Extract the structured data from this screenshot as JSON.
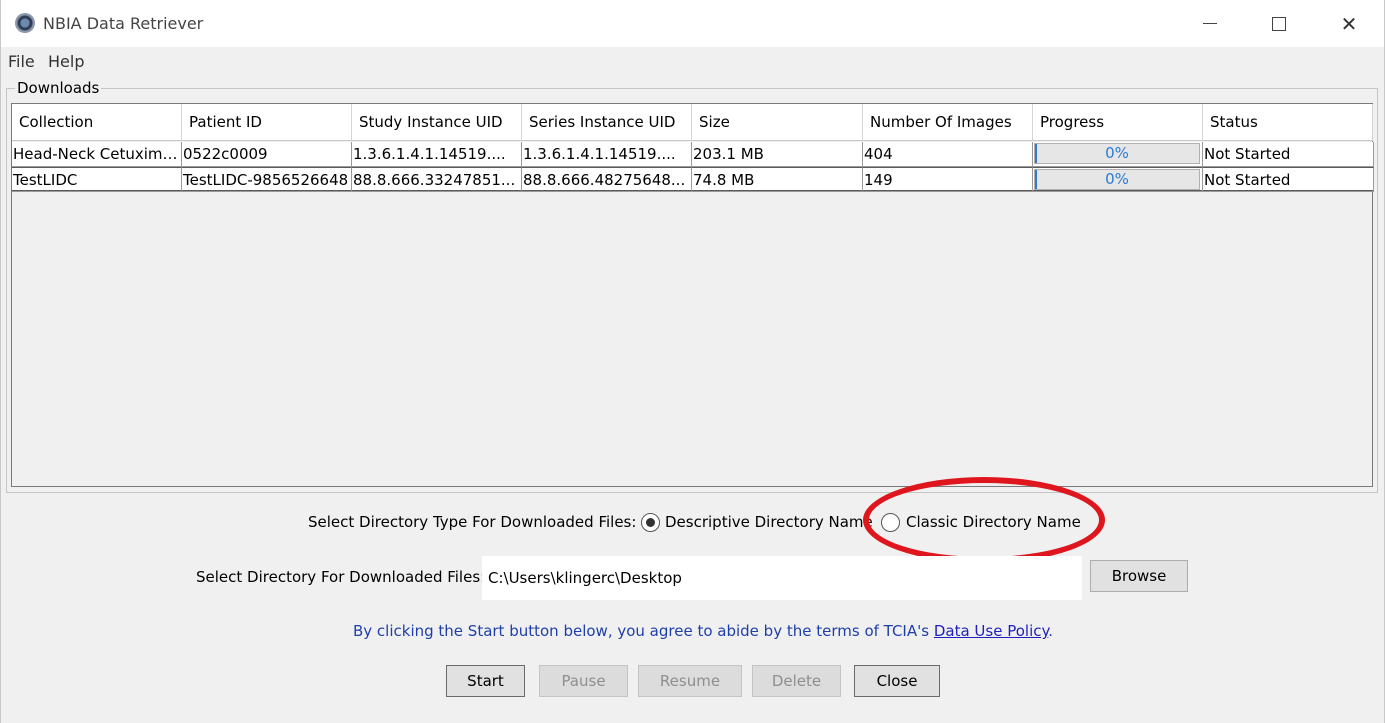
{
  "window": {
    "title": "NBIA Data Retriever",
    "minimize_icon": "minimize-icon",
    "maximize_icon": "maximize-icon",
    "close_glyph": "✕"
  },
  "menu": {
    "items": [
      "File",
      "Help"
    ]
  },
  "downloads": {
    "group_label": "Downloads",
    "columns": [
      "Collection",
      "Patient ID",
      "Study Instance UID",
      "Series Instance UID",
      "Size",
      "Number Of Images",
      "Progress",
      "Status"
    ],
    "rows": [
      {
        "collection": "Head-Neck Cetuximab",
        "patient_id": "0522c0009",
        "study_uid": "1.3.6.1.4.1.14519....",
        "series_uid": "1.3.6.1.4.1.14519....",
        "size": "203.1 MB",
        "num_images": "404",
        "progress_text": "0%",
        "progress_fraction": 0,
        "status": "Not Started"
      },
      {
        "collection": "TestLIDC",
        "patient_id": "TestLIDC-9856526648",
        "study_uid": "88.8.666.33247851...",
        "series_uid": "88.8.666.48275648...",
        "size": "74.8 MB",
        "num_images": "149",
        "progress_text": "0%",
        "progress_fraction": 0,
        "status": "Not Started"
      }
    ]
  },
  "directory_type": {
    "label": "Select Directory Type For Downloaded Files:",
    "options": [
      "Descriptive Directory Name",
      "Classic Directory Name"
    ],
    "selected": "Descriptive Directory Name"
  },
  "directory": {
    "label": "Select Directory For Downloaded Files:",
    "value": "C:\\Users\\klingerc\\Desktop",
    "browse_label": "Browse"
  },
  "agreement": {
    "text": "By clicking the Start button below, you agree to abide by the terms of TCIA's",
    "link": "Data Use Policy",
    "suffix": "."
  },
  "buttons": {
    "start": "Start",
    "pause": "Pause",
    "resume": "Resume",
    "delete": "Delete",
    "close": "Close"
  },
  "colors": {
    "highlight": "#e0161f",
    "progress_text": "#2a7bd5",
    "link": "#1f1fbf"
  }
}
